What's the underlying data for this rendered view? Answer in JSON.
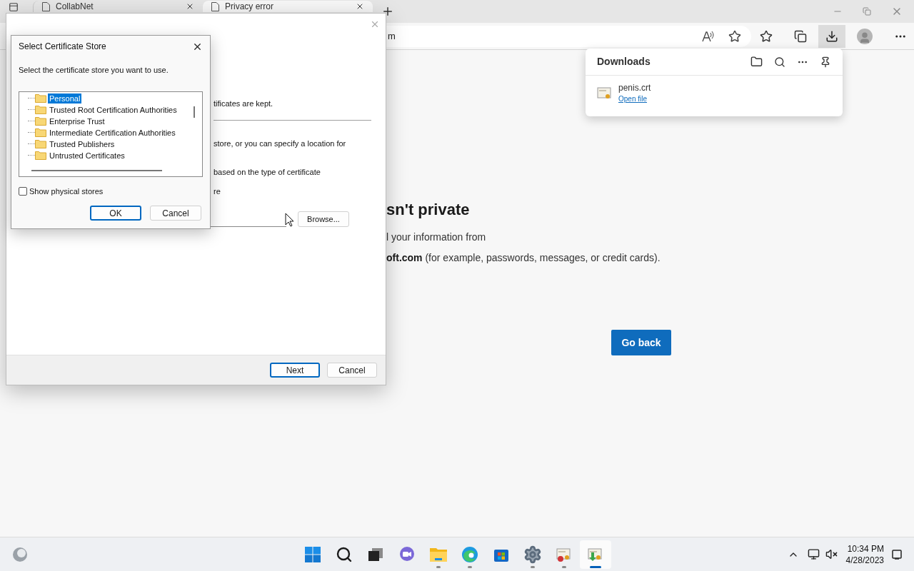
{
  "browser": {
    "tabs": [
      {
        "title": "CollabNet",
        "selected": false
      },
      {
        "title": "Privacy error",
        "selected": true
      }
    ],
    "address": "m",
    "downloads_button": {
      "selected": true
    },
    "downloads_panel": {
      "title": "Downloads",
      "items": [
        {
          "name": "penis.crt",
          "action": "Open file"
        }
      ]
    },
    "page": {
      "heading": "sn't private",
      "line_1": "l your information from",
      "line_2": "**oft.com** (for example, passwords, messages, or credit cards).",
      "button": "Go back"
    }
  },
  "wizard": {
    "text_1": "tificates are kept.",
    "text_2": "store, or you can specify a location for",
    "text_3": "based on the type of certificate",
    "text_4": "re",
    "browse_button": "Browse...",
    "buttons": [
      {
        "label": "Next",
        "focused": true
      },
      {
        "label": "Cancel",
        "focused": false
      }
    ]
  },
  "store_dialog": {
    "title": "Select Certificate Store",
    "prompt": "Select the certificate store you want to use.",
    "stores": [
      {
        "name": "Personal",
        "selected": true
      },
      {
        "name": "Trusted Root Certification Authorities",
        "selected": false
      },
      {
        "name": "Enterprise Trust",
        "selected": false
      },
      {
        "name": "Intermediate Certification Authorities",
        "selected": false
      },
      {
        "name": "Trusted Publishers",
        "selected": false
      },
      {
        "name": "Untrusted Certificates",
        "selected": false
      }
    ],
    "show_physical_stores": {
      "label": "Show physical stores",
      "checked": false
    },
    "buttons": [
      {
        "label": "OK",
        "focused": true
      },
      {
        "label": "Cancel",
        "focused": false
      }
    ]
  },
  "taskbar": {
    "apps": [
      {
        "kind": "start",
        "running": false,
        "active": false
      },
      {
        "kind": "search",
        "running": false,
        "active": false
      },
      {
        "kind": "taskview",
        "running": false,
        "active": false
      },
      {
        "kind": "chat",
        "running": false,
        "active": false
      },
      {
        "kind": "explorer",
        "running": true,
        "active": false
      },
      {
        "kind": "edge",
        "running": true,
        "active": false
      },
      {
        "kind": "store",
        "running": false,
        "active": false
      },
      {
        "kind": "settings",
        "running": true,
        "active": false
      },
      {
        "kind": "certmgr",
        "running": true,
        "active": false
      },
      {
        "kind": "certwizard",
        "running": true,
        "active": true
      }
    ],
    "time": "10:34 PM",
    "date": "4/28/2023"
  }
}
